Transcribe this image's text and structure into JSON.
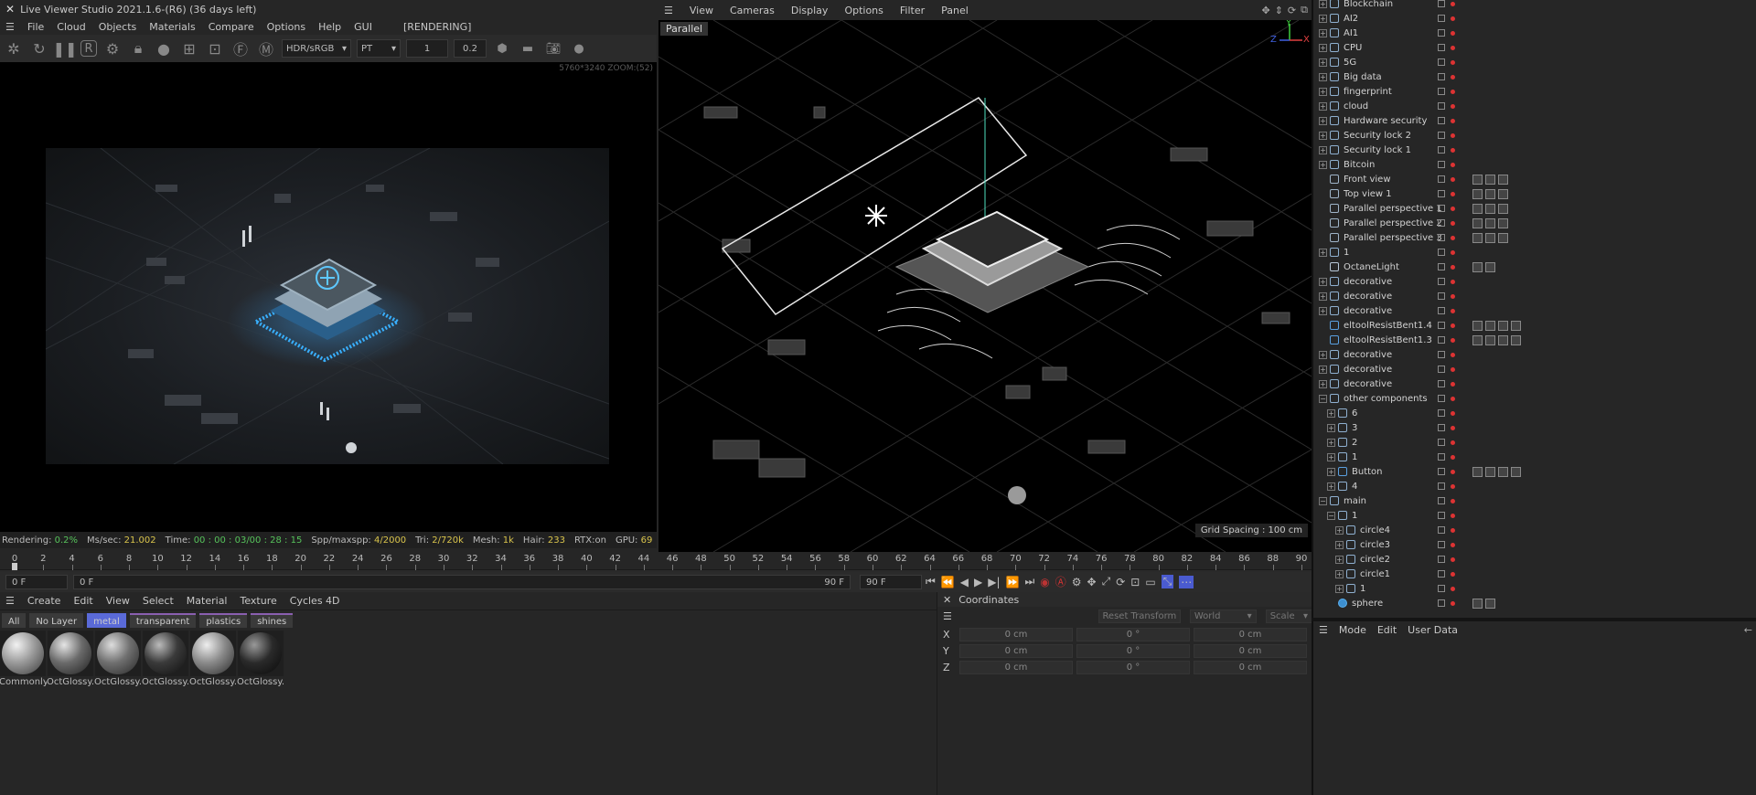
{
  "live_viewer": {
    "title": "Live Viewer Studio 2021.1.6-(R6) (36 days left)",
    "menu": [
      "File",
      "Cloud",
      "Objects",
      "Materials",
      "Compare",
      "Options",
      "Help",
      "GUI"
    ],
    "state": "[RENDERING]",
    "color_space": "HDR/sRGB",
    "kernel": "PT",
    "field1": "1",
    "field2": "0.2",
    "resolution_label": "5760*3240 ZOOM:(52)",
    "status": {
      "rendering_label": "Rendering:",
      "rendering_value": "0.2%",
      "ms_label": "Ms/sec:",
      "ms_value": "21.002",
      "time_label": "Time:",
      "time_value": "00 : 00 : 03/00 : 28 : 15",
      "spp_label": "Spp/maxspp:",
      "spp_value": "4/2000",
      "tri_label": "Tri:",
      "tri_value": "2/720k",
      "mesh_label": "Mesh:",
      "mesh_value": "1k",
      "hair_label": "Hair:",
      "hair_value": "233",
      "rtx_label": "RTX:on",
      "gpu_label": "GPU:",
      "gpu_value": "69"
    }
  },
  "viewport": {
    "menu": [
      "View",
      "Cameras",
      "Display",
      "Options",
      "Filter",
      "Panel"
    ],
    "projection": "Parallel",
    "grid_spacing": "Grid Spacing : 100 cm",
    "axis_y": "Y",
    "axis_x": "X",
    "axis_z": "Z"
  },
  "timeline": {
    "ticks": [
      "0",
      "2",
      "4",
      "6",
      "8",
      "10",
      "12",
      "14",
      "16",
      "18",
      "20",
      "22",
      "24",
      "26",
      "28",
      "30",
      "32",
      "34",
      "36",
      "38",
      "40",
      "42",
      "44",
      "46",
      "48",
      "50",
      "52",
      "54",
      "56",
      "58",
      "60",
      "62",
      "64",
      "66",
      "68",
      "70",
      "72",
      "74",
      "76",
      "78",
      "80",
      "82",
      "84",
      "86",
      "88",
      "90"
    ],
    "current_frame": "0 F",
    "start_frame": "0 F",
    "end_frame": "90 F",
    "end_frame2": "90 F"
  },
  "material_manager": {
    "menu": [
      "Create",
      "Edit",
      "View",
      "Select",
      "Material",
      "Texture",
      "Cycles 4D"
    ],
    "tags": [
      {
        "label": "All",
        "color": "#3a3a3a"
      },
      {
        "label": "No Layer",
        "color": "#3a3a3a"
      },
      {
        "label": "metal",
        "color": "#5a6ad8"
      },
      {
        "label": "transparent",
        "color": "#3a3a3a"
      },
      {
        "label": "plastics",
        "color": "#3a3a3a"
      },
      {
        "label": "shines",
        "color": "#3a3a3a"
      }
    ],
    "materials": [
      "Commonly",
      "OctGlossy.",
      "OctGlossy.",
      "OctGlossy.",
      "OctGlossy.",
      "OctGlossy."
    ]
  },
  "coordinates": {
    "title": "Coordinates",
    "reset_transform": "Reset Transform",
    "world": "World",
    "scale": "Scale",
    "rows": [
      {
        "axis": "X",
        "pos": "0 cm",
        "rot": "0 °",
        "size": "0 cm"
      },
      {
        "axis": "Y",
        "pos": "0 cm",
        "rot": "0 °",
        "size": "0 cm"
      },
      {
        "axis": "Z",
        "pos": "0 cm",
        "rot": "0 °",
        "size": "0 cm"
      }
    ]
  },
  "object_manager": {
    "objects": [
      {
        "name": "Blockchain",
        "level": 0,
        "exp": "+",
        "kind": "null"
      },
      {
        "name": "AI2",
        "level": 0,
        "exp": "+",
        "kind": "null"
      },
      {
        "name": "AI1",
        "level": 0,
        "exp": "+",
        "kind": "null"
      },
      {
        "name": "CPU",
        "level": 0,
        "exp": "+",
        "kind": "null"
      },
      {
        "name": "5G",
        "level": 0,
        "exp": "+",
        "kind": "null"
      },
      {
        "name": "Big data",
        "level": 0,
        "exp": "+",
        "kind": "null"
      },
      {
        "name": "fingerprint",
        "level": 0,
        "exp": "+",
        "kind": "null"
      },
      {
        "name": "cloud",
        "level": 0,
        "exp": "+",
        "kind": "null"
      },
      {
        "name": "Hardware security",
        "level": 0,
        "exp": "+",
        "kind": "null"
      },
      {
        "name": "Security lock 2",
        "level": 0,
        "exp": "+",
        "kind": "null"
      },
      {
        "name": "Security lock 1",
        "level": 0,
        "exp": "+",
        "kind": "null"
      },
      {
        "name": "Bitcoin",
        "level": 0,
        "exp": "+",
        "kind": "null"
      },
      {
        "name": "Front view",
        "level": 0,
        "exp": "",
        "kind": "camera"
      },
      {
        "name": "Top view  1",
        "level": 0,
        "exp": "",
        "kind": "camera"
      },
      {
        "name": "Parallel perspective 1",
        "level": 0,
        "exp": "",
        "kind": "camera"
      },
      {
        "name": "Parallel perspective 2",
        "level": 0,
        "exp": "",
        "kind": "camera"
      },
      {
        "name": "Parallel perspective 3",
        "level": 0,
        "exp": "",
        "kind": "camera"
      },
      {
        "name": "1",
        "level": 0,
        "exp": "+",
        "kind": "null"
      },
      {
        "name": "OctaneLight",
        "level": 0,
        "exp": "",
        "kind": "light"
      },
      {
        "name": "decorative",
        "level": 0,
        "exp": "+",
        "kind": "null"
      },
      {
        "name": "decorative",
        "level": 0,
        "exp": "+",
        "kind": "null"
      },
      {
        "name": "decorative",
        "level": 0,
        "exp": "+",
        "kind": "null"
      },
      {
        "name": "eltoolResistBent1.4",
        "level": 0,
        "exp": "",
        "kind": "mesh"
      },
      {
        "name": "eltoolResistBent1.3",
        "level": 0,
        "exp": "",
        "kind": "mesh"
      },
      {
        "name": "decorative",
        "level": 0,
        "exp": "+",
        "kind": "null"
      },
      {
        "name": "decorative",
        "level": 0,
        "exp": "+",
        "kind": "null"
      },
      {
        "name": "decorative",
        "level": 0,
        "exp": "+",
        "kind": "null"
      },
      {
        "name": "other components",
        "level": 0,
        "exp": "−",
        "kind": "null"
      },
      {
        "name": "6",
        "level": 1,
        "exp": "+",
        "kind": "null"
      },
      {
        "name": "3",
        "level": 1,
        "exp": "+",
        "kind": "null"
      },
      {
        "name": "2",
        "level": 1,
        "exp": "+",
        "kind": "null"
      },
      {
        "name": "1",
        "level": 1,
        "exp": "+",
        "kind": "null"
      },
      {
        "name": "Button",
        "level": 1,
        "exp": "+",
        "kind": "mesh"
      },
      {
        "name": "4",
        "level": 1,
        "exp": "+",
        "kind": "null"
      },
      {
        "name": "main",
        "level": 0,
        "exp": "−",
        "kind": "null"
      },
      {
        "name": "1",
        "level": 1,
        "exp": "−",
        "kind": "null"
      },
      {
        "name": "circle4",
        "level": 2,
        "exp": "+",
        "kind": "null"
      },
      {
        "name": "circle3",
        "level": 2,
        "exp": "+",
        "kind": "null"
      },
      {
        "name": "circle2",
        "level": 2,
        "exp": "+",
        "kind": "null"
      },
      {
        "name": "circle1",
        "level": 2,
        "exp": "+",
        "kind": "null"
      },
      {
        "name": "1",
        "level": 2,
        "exp": "+",
        "kind": "null"
      },
      {
        "name": "sphere",
        "level": 1,
        "exp": "",
        "kind": "sphere"
      }
    ]
  },
  "attributes": {
    "menu": [
      "Mode",
      "Edit",
      "User Data"
    ]
  }
}
